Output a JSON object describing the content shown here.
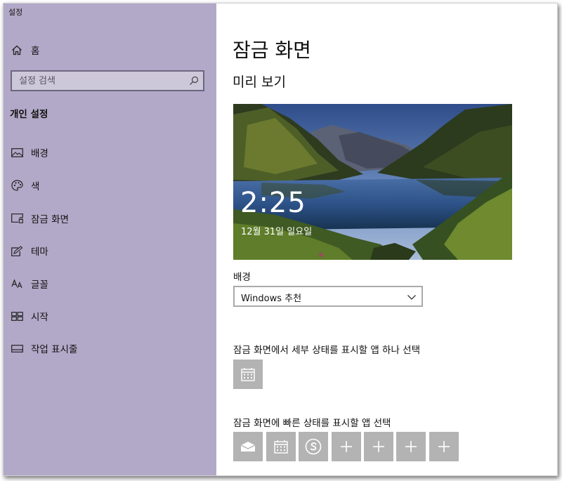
{
  "window": {
    "title": "설정"
  },
  "sidebar": {
    "home_label": "홈",
    "search_placeholder": "설정 검색",
    "section_label": "개인 설정",
    "items": [
      {
        "label": "배경",
        "icon": "image-icon"
      },
      {
        "label": "색",
        "icon": "palette-icon"
      },
      {
        "label": "잠금 화면",
        "icon": "lock-screen-icon"
      },
      {
        "label": "테마",
        "icon": "theme-icon"
      },
      {
        "label": "글꼴",
        "icon": "font-icon"
      },
      {
        "label": "시작",
        "icon": "start-icon"
      },
      {
        "label": "작업 표시줄",
        "icon": "taskbar-icon"
      }
    ]
  },
  "main": {
    "title": "잠금 화면",
    "preview_label": "미리 보기",
    "preview": {
      "time": "2:25",
      "date": "12월 31일 일요일"
    },
    "background_label": "배경",
    "background_value": "Windows 추천",
    "detail_label": "잠금 화면에서 세부 상태를 표시할 앱 하나 선택",
    "detail_app": {
      "icon": "calendar-icon"
    },
    "quick_label": "잠금 화면에 빠른 상태를 표시할 앱 선택",
    "quick_apps": [
      {
        "icon": "mail-icon"
      },
      {
        "icon": "calendar-icon"
      },
      {
        "icon": "skype-icon"
      },
      {
        "icon": "plus-icon"
      },
      {
        "icon": "plus-icon"
      },
      {
        "icon": "plus-icon"
      },
      {
        "icon": "plus-icon"
      }
    ]
  },
  "colors": {
    "sidebar_bg": "#b2a9c8",
    "tile_bg": "#b3b3b3",
    "text": "#111111"
  }
}
